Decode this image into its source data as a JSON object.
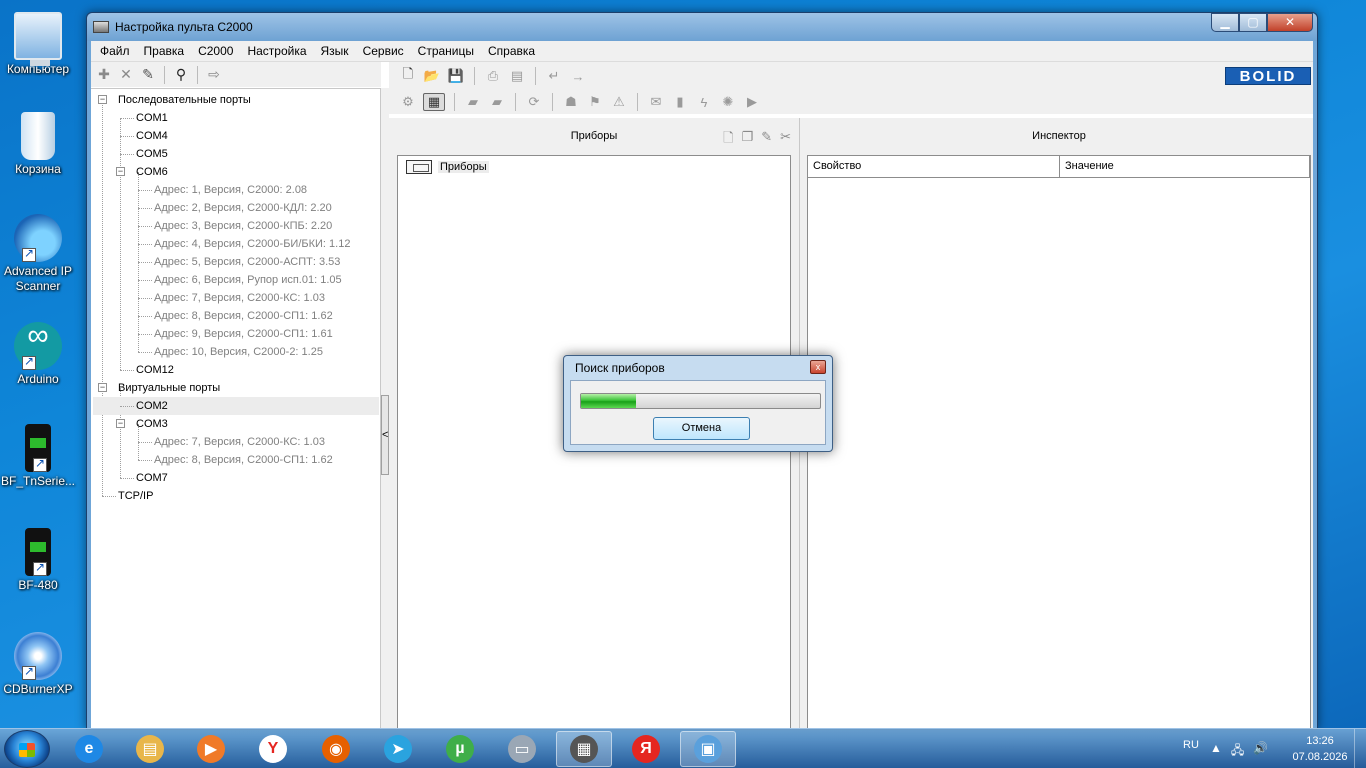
{
  "desktop": {
    "icons": [
      {
        "label": "Компьютер",
        "icon": "computer-icon"
      },
      {
        "label": "Корзина",
        "icon": "recycle-bin-icon"
      },
      {
        "label": "Advanced IP Scanner",
        "icon": "network-scanner-icon"
      },
      {
        "label": "Arduino",
        "icon": "arduino-icon"
      },
      {
        "label": "BF_TnSerie...",
        "icon": "radio-icon"
      },
      {
        "label": "BF-480",
        "icon": "radio-icon"
      },
      {
        "label": "CDBurnerXP",
        "icon": "cd-icon"
      }
    ]
  },
  "window": {
    "title": "Настройка пульта С2000",
    "controls": {
      "minimize": "▁",
      "maximize": "▢",
      "close": "✕"
    }
  },
  "menu": [
    "Файл",
    "Правка",
    "С2000",
    "Настройка",
    "Язык",
    "Сервис",
    "Страницы",
    "Справка"
  ],
  "tree": {
    "serial_ports": "Последовательные порты",
    "com1": "COM1",
    "com4": "COM4",
    "com5": "COM5",
    "com6": "COM6",
    "com6_devices": [
      "Адрес: 1, Версия, С2000: 2.08",
      "Адрес: 2, Версия, С2000-КДЛ: 2.20",
      "Адрес: 3, Версия, С2000-КПБ: 2.20",
      "Адрес: 4, Версия, С2000-БИ/БКИ: 1.12",
      "Адрес: 5, Версия, С2000-АСПТ: 3.53",
      "Адрес: 6, Версия, Рупор исп.01: 1.05",
      "Адрес: 7, Версия, С2000-КС: 1.03",
      "Адрес: 8, Версия, С2000-СП1: 1.62",
      "Адрес: 9, Версия, С2000-СП1: 1.61",
      "Адрес: 10, Версия, С2000-2: 1.25"
    ],
    "com12": "COM12",
    "virtual_ports": "Виртуальные порты",
    "com2": "COM2",
    "com3": "COM3",
    "com3_devices": [
      "Адрес: 7, Версия, С2000-КС: 1.03",
      "Адрес: 8, Версия, С2000-СП1: 1.62"
    ],
    "com7": "COM7",
    "tcpip": "TCP/IP",
    "expander_collapse": "−",
    "splitter_arrow": "<"
  },
  "brand": {
    "logo_text": "BOLID",
    "color": "#1a5fb4"
  },
  "devices_panel": {
    "title": "Приборы",
    "root_label": "Приборы"
  },
  "inspector": {
    "title": "Инспектор",
    "columns": [
      "Свойство",
      "Значение"
    ]
  },
  "dialog": {
    "title": "Поиск приборов",
    "progress_fraction": 0.23,
    "cancel_label": "Отмена",
    "close": "x"
  },
  "taskbar": {
    "apps": [
      {
        "name": "internet-explorer",
        "glyph": "e",
        "color": "#1e88e5"
      },
      {
        "name": "file-explorer",
        "glyph": "▤",
        "color": "#e8b64a"
      },
      {
        "name": "media-player",
        "glyph": "▶",
        "color": "#f07a28"
      },
      {
        "name": "yandex-browser",
        "glyph": "Y",
        "color": "#ffffff"
      },
      {
        "name": "firefox",
        "glyph": "◉",
        "color": "#e66000"
      },
      {
        "name": "telegram",
        "glyph": "➤",
        "color": "#2aa3df"
      },
      {
        "name": "utorrent",
        "glyph": "µ",
        "color": "#3fae49"
      },
      {
        "name": "device-tool",
        "glyph": "▭",
        "color": "#9aa7b5"
      },
      {
        "name": "chip-tool",
        "glyph": "▦",
        "color": "#555555"
      },
      {
        "name": "yandex",
        "glyph": "Я",
        "color": "#e52620"
      },
      {
        "name": "control-panel",
        "glyph": "▣",
        "color": "#5aa0dc"
      }
    ],
    "lang": "RU",
    "time": "13:26",
    "date": "07.08.2026"
  }
}
